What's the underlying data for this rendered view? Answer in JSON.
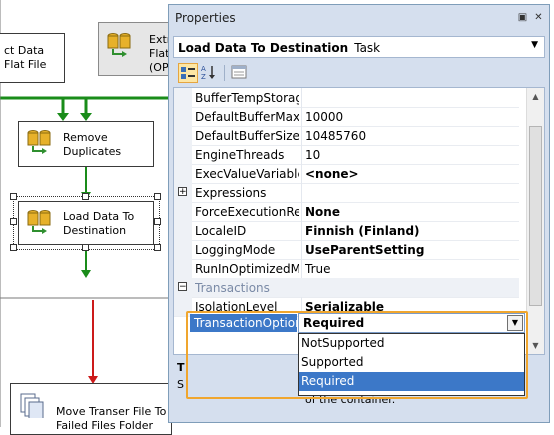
{
  "canvas": {
    "tasks": [
      {
        "id": "extract-left",
        "label": "ct Data\nFlat File"
      },
      {
        "id": "extract-right",
        "label": "Extr\nFlat\n(OP"
      },
      {
        "id": "remove-duplicates",
        "label": "Remove\nDuplicates"
      },
      {
        "id": "load-data",
        "label": "Load Data To\nDestination"
      },
      {
        "id": "move-file",
        "label": "Move Transer File To\nFailed Files Folder"
      }
    ]
  },
  "properties": {
    "title": "Properties",
    "pin_glyph": "▣",
    "close_glyph": "✕",
    "object_name": "Load Data To Destination",
    "object_type": "Task",
    "rows": [
      {
        "name": "BufferTempStorage",
        "value": "",
        "bold": false
      },
      {
        "name": "DefaultBufferMaxRc",
        "value": "10000",
        "bold": false
      },
      {
        "name": "DefaultBufferSize",
        "value": "10485760",
        "bold": false
      },
      {
        "name": "EngineThreads",
        "value": "10",
        "bold": false
      },
      {
        "name": "ExecValueVariable",
        "value": "<none>",
        "bold": true
      },
      {
        "name": "Expressions",
        "value": "",
        "bold": false,
        "expander": "+"
      },
      {
        "name": "ForceExecutionResu",
        "value": "None",
        "bold": true
      },
      {
        "name": "LocaleID",
        "value": "Finnish (Finland)",
        "bold": true
      },
      {
        "name": "LoggingMode",
        "value": "UseParentSetting",
        "bold": true
      },
      {
        "name": "RunInOptimizedMo",
        "value": "True",
        "bold": false
      },
      {
        "name": "Transactions",
        "value": "",
        "bold": false,
        "category": true,
        "expander": "−"
      },
      {
        "name": "IsolationLevel",
        "value": "Serializable",
        "bold": true
      }
    ],
    "transaction_option": {
      "name": "TransactionOption",
      "value": "Required",
      "options": [
        "NotSupported",
        "Supported",
        "Required"
      ],
      "selected_index": 2
    },
    "description": {
      "title": "T",
      "text_prefix": "S",
      "text_tail": "of the container."
    }
  },
  "colors": {
    "accent": "#3c78c8",
    "highlight_border": "#f0a62e",
    "panel_bg": "#d5dfee"
  }
}
